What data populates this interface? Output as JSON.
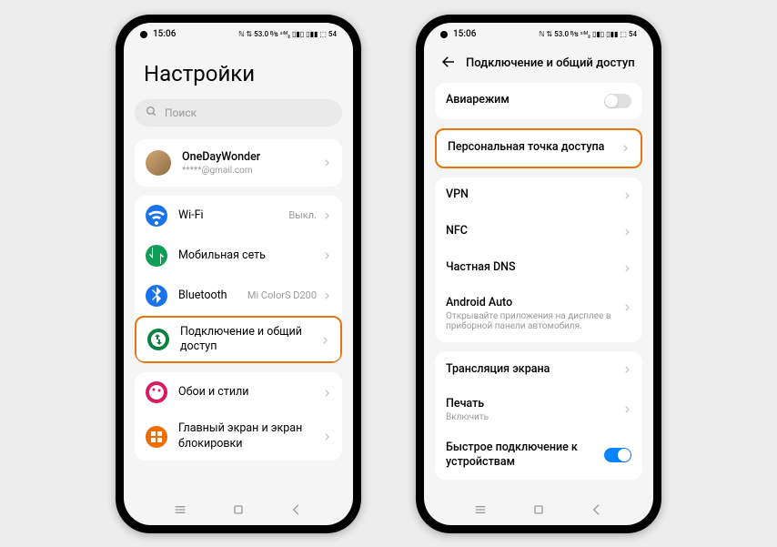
{
  "status": {
    "time": "15:06",
    "right_icons": "ℕ  ⇅ 53.0  ᴮ∕s  ˢⁱᴹ₂ ▯▮▯ ▯▮▮  ⬚ 54"
  },
  "phone1": {
    "title": "Настройки",
    "search_placeholder": "Поиск",
    "account": {
      "name": "OneDayWonder",
      "email": "*****@gmail.com"
    },
    "rows": {
      "wifi": {
        "label": "Wi-Fi",
        "value": "Выкл."
      },
      "mobile": {
        "label": "Мобильная сеть"
      },
      "bt": {
        "label": "Bluetooth",
        "value": "Mi ColorS D200"
      },
      "conn": {
        "label": "Подключение и общий доступ"
      },
      "wall": {
        "label": "Обои и стили"
      },
      "lock": {
        "label": "Главный экран и экран блокировки"
      }
    }
  },
  "phone2": {
    "header": "Подключение и общий доступ",
    "rows": {
      "airplane": {
        "label": "Авиарежим"
      },
      "hotspot": {
        "label": "Персональная точка доступа"
      },
      "vpn": {
        "label": "VPN"
      },
      "nfc": {
        "label": "NFC"
      },
      "dns": {
        "label": "Частная DNS"
      },
      "aauto": {
        "label": "Android Auto",
        "sub": "Открывайте приложения на дисплее в приборной панели автомобиля."
      },
      "cast": {
        "label": "Трансляция экрана"
      },
      "print": {
        "label": "Печать",
        "sub": "Включить"
      },
      "fast": {
        "label": "Быстрое подключение к устройствам"
      }
    }
  }
}
